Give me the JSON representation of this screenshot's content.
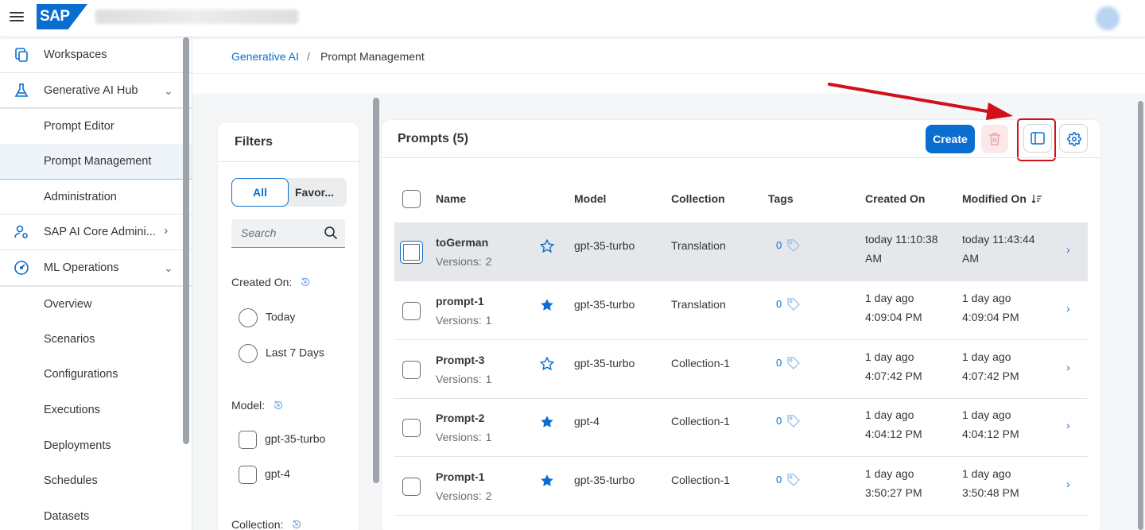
{
  "shell": {
    "logo_text": "SAP",
    "title_redacted": true
  },
  "breadcrumb": {
    "parent": "Generative AI",
    "separator": "/",
    "current": "Prompt Management"
  },
  "sidebar": {
    "items": [
      {
        "label": "Workspaces",
        "icon": "workspaces-icon"
      },
      {
        "label": "Generative AI Hub",
        "icon": "flask-icon",
        "expanded": true
      },
      {
        "label": "Prompt Editor"
      },
      {
        "label": "Prompt Management",
        "selected": true
      },
      {
        "label": "Administration"
      },
      {
        "label": "SAP AI Core Admini...",
        "icon": "admin-user-icon",
        "expanded": false
      },
      {
        "label": "ML Operations",
        "icon": "gauge-icon",
        "expanded": true
      },
      {
        "label": "Overview"
      },
      {
        "label": "Scenarios"
      },
      {
        "label": "Configurations"
      },
      {
        "label": "Executions"
      },
      {
        "label": "Deployments"
      },
      {
        "label": "Schedules"
      },
      {
        "label": "Datasets"
      }
    ]
  },
  "filters": {
    "title": "Filters",
    "segment_all": "All",
    "segment_fav": "Favor...",
    "search_placeholder": "Search",
    "created_on_label": "Created On:",
    "created_options": [
      "Today",
      "Last 7 Days"
    ],
    "model_label": "Model:",
    "model_options": [
      "gpt-35-turbo",
      "gpt-4"
    ],
    "collection_label": "Collection:"
  },
  "prompts": {
    "title": "Prompts (5)",
    "create_label": "Create",
    "columns": [
      "Name",
      "Model",
      "Collection",
      "Tags",
      "Created On",
      "Modified On"
    ],
    "versions_label": "Versions:",
    "rows": [
      {
        "name": "toGerman",
        "versions": "2",
        "favorite": false,
        "model": "gpt-35-turbo",
        "collection": "Translation",
        "tags": "0",
        "created_1": "today 11:10:38",
        "created_2": "AM",
        "modified_1": "today 11:43:44",
        "modified_2": "AM",
        "selected": true
      },
      {
        "name": "prompt-1",
        "versions": "1",
        "favorite": true,
        "model": "gpt-35-turbo",
        "collection": "Translation",
        "tags": "0",
        "created_1": "1 day ago",
        "created_2": "4:09:04 PM",
        "modified_1": "1 day ago",
        "modified_2": "4:09:04 PM"
      },
      {
        "name": "Prompt-3",
        "versions": "1",
        "favorite": false,
        "model": "gpt-35-turbo",
        "collection": "Collection-1",
        "tags": "0",
        "created_1": "1 day ago",
        "created_2": "4:07:42 PM",
        "modified_1": "1 day ago",
        "modified_2": "4:07:42 PM"
      },
      {
        "name": "Prompt-2",
        "versions": "1",
        "favorite": true,
        "model": "gpt-4",
        "collection": "Collection-1",
        "tags": "0",
        "created_1": "1 day ago",
        "created_2": "4:04:12 PM",
        "modified_1": "1 day ago",
        "modified_2": "4:04:12 PM"
      },
      {
        "name": "Prompt-1",
        "versions": "2",
        "favorite": true,
        "model": "gpt-35-turbo",
        "collection": "Collection-1",
        "tags": "0",
        "created_1": "1 day ago",
        "created_2": "3:50:27 PM",
        "modified_1": "1 day ago",
        "modified_2": "3:50:48 PM"
      }
    ]
  },
  "colors": {
    "accent": "#0a6ed1",
    "annotation": "#d0111b",
    "selected_row": "#e5e7ea"
  }
}
